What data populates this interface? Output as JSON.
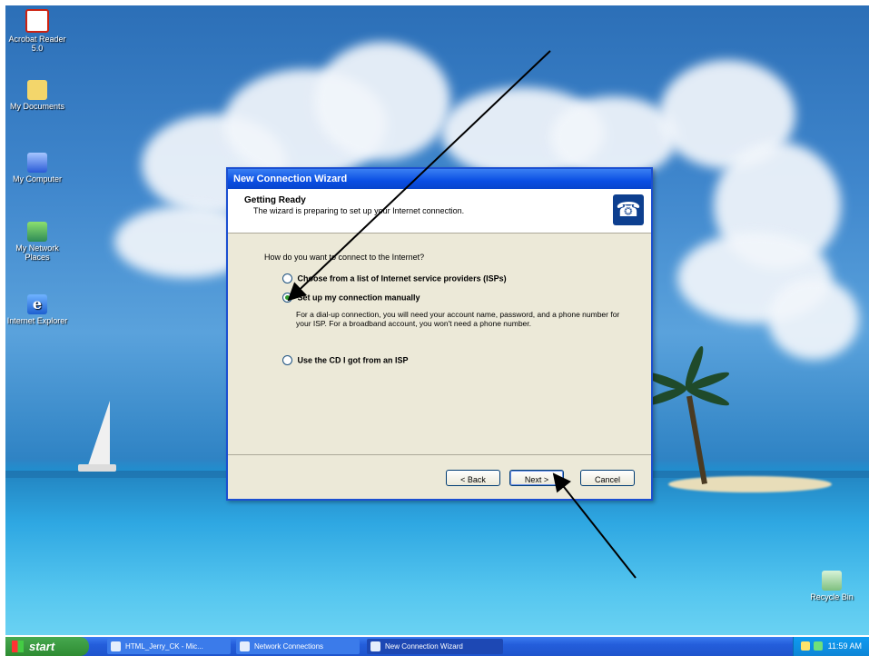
{
  "desktop": {
    "icons": [
      {
        "label": "Acrobat Reader 5.0",
        "icon": "acrobat-icon"
      },
      {
        "label": "My Documents",
        "icon": "folder-icon"
      },
      {
        "label": "My Computer",
        "icon": "computer-icon"
      },
      {
        "label": "My Network Places",
        "icon": "network-icon"
      },
      {
        "label": "Internet Explorer",
        "icon": "ie-icon"
      }
    ],
    "recycle_bin": {
      "label": "Recycle Bin",
      "icon": "recycle-bin-icon"
    }
  },
  "wizard": {
    "title": "New Connection Wizard",
    "header_title": "Getting Ready",
    "header_subtitle": "The wizard is preparing to set up your Internet connection.",
    "question": "How do you want to connect to the Internet?",
    "options": [
      {
        "label": "Choose from a list of Internet service providers (ISPs)",
        "selected": false
      },
      {
        "label": "Set up my connection manually",
        "selected": true
      },
      {
        "label": "Use the CD I got from an ISP",
        "selected": false
      }
    ],
    "manual_description": "For a dial-up connection, you will need your account name, password, and a phone number for your ISP. For a broadband account, you won't need a phone number.",
    "buttons": {
      "back": "< Back",
      "next": "Next >",
      "cancel": "Cancel"
    }
  },
  "taskbar": {
    "start_label": "start",
    "tasks": [
      {
        "label": "HTML_Jerry_CK - Mic..."
      },
      {
        "label": "Network Connections"
      },
      {
        "label": "New Connection Wizard"
      }
    ],
    "clock": "11:59 AM"
  },
  "colors": {
    "title_bar": "#0a4ee3",
    "taskbar": "#245edb",
    "start_button": "#2e8c32",
    "selected_radio": "#2c9a2c"
  }
}
